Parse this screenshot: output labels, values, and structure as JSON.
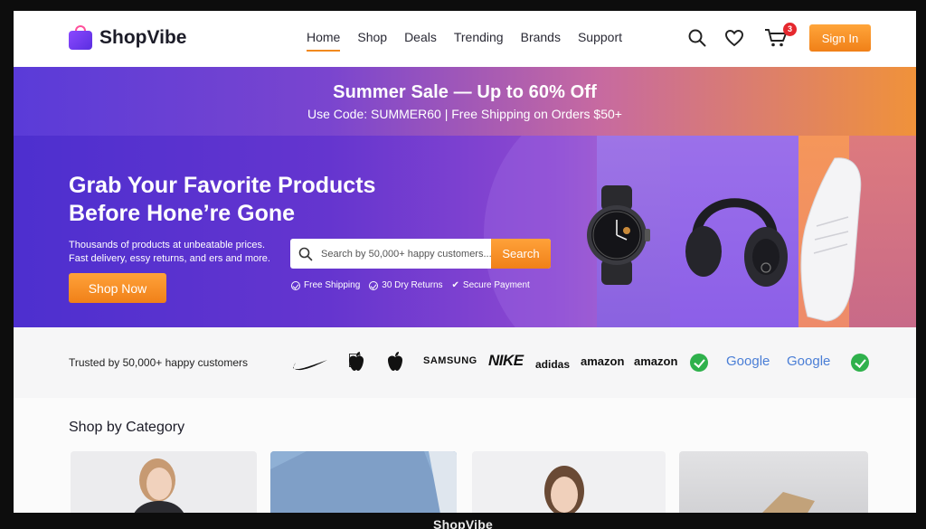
{
  "app": {
    "name": "ShopVibe"
  },
  "header": {
    "nav": [
      "Home",
      "Shop",
      "Deals",
      "Trending",
      "Brands",
      "Support"
    ],
    "active_nav": "Home",
    "cart_count": "3",
    "sign_in": "Sign In"
  },
  "promo": {
    "title": "Summer Sale — Up to 60% Off",
    "subtitle": "Use Code: SUMMER60 | Free Shipping on Orders $50+"
  },
  "hero": {
    "title_line1": "Grab Your Favorite Products",
    "title_line2": "Before Hone’re Gone",
    "desc_line1": "Thousands of products at unbeatable prices.",
    "desc_line2": "Fast delivery, essy returns, and ers and more.",
    "cta": "Shop Now",
    "search_placeholder": "Search by 50,000+ happy customers...",
    "search_button": "Search",
    "features": [
      "Free Shipping",
      "30 Dry Returns",
      "Secure Payment"
    ]
  },
  "trusted": {
    "label": "Trusted by 50,000+ happy customers",
    "brands": [
      "SAMSUNG",
      "NIKE",
      "adidas",
      "amazon",
      "amazon",
      "Google",
      "Google"
    ]
  },
  "category": {
    "title": "Shop by Category"
  },
  "colors": {
    "accent": "#f08018",
    "primary": "#5a3bd8",
    "badge": "#e5282e"
  }
}
